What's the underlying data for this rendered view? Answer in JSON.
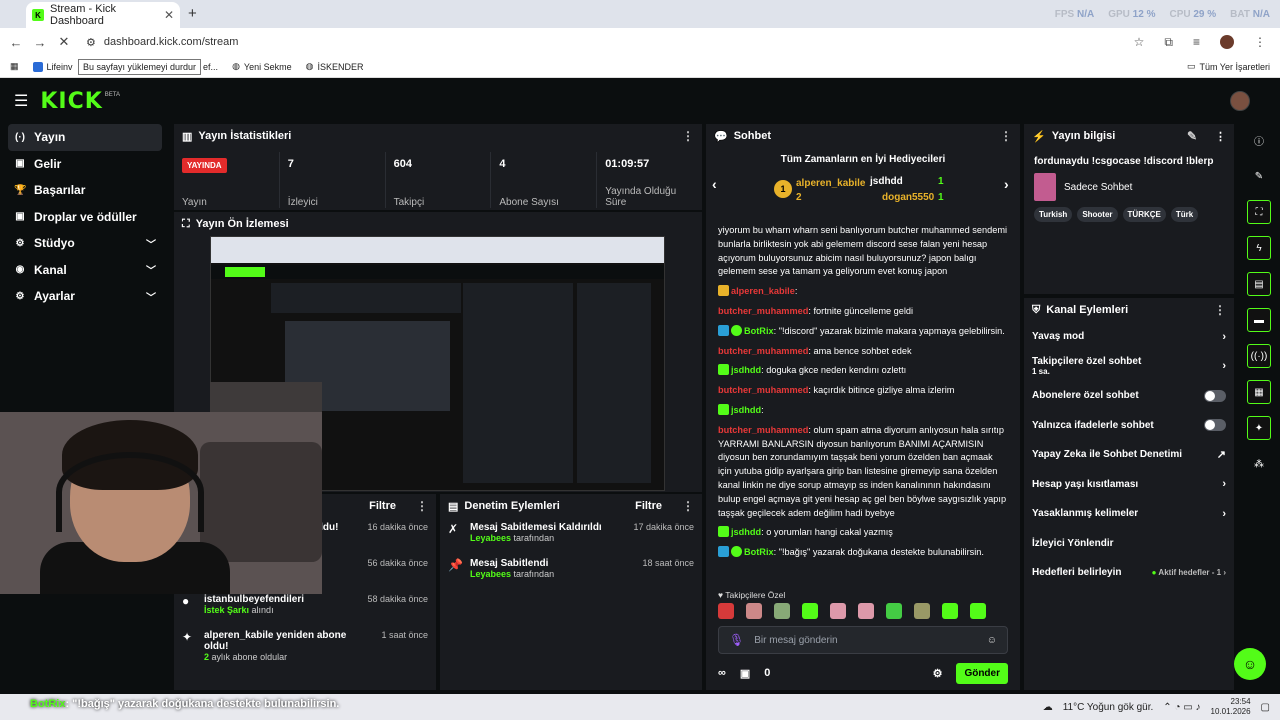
{
  "browser": {
    "tab_title": "Stream - Kick Dashboard",
    "url": "dashboard.kick.com/stream",
    "tooltip": "Bu sayfayı yüklemeyi durdur",
    "bookmarks": [
      "Lifeinv",
      "ancı çizgi film ef...",
      "Yeni Sekme",
      "İSKENDER"
    ],
    "all_bookmarks": "Tüm Yer İşaretleri",
    "overlay": {
      "fps_label": "FPS",
      "fps": "N/A",
      "gpu_label": "GPU",
      "gpu": "12 %",
      "cpu_label": "CPU",
      "cpu": "29 %",
      "bat_label": "BAT",
      "bat": "N/A"
    }
  },
  "brand": {
    "logo": "KICK",
    "beta": "BETA"
  },
  "sidebar": [
    {
      "label": "Yayın",
      "icon": "(·)"
    },
    {
      "label": "Gelir",
      "icon": "▣"
    },
    {
      "label": "Başarılar",
      "icon": "🏆"
    },
    {
      "label": "Droplar ve ödüller",
      "icon": "▣"
    },
    {
      "label": "Stüdyo",
      "icon": "⚙"
    },
    {
      "label": "Kanal",
      "icon": "◉"
    },
    {
      "label": "Ayarlar",
      "icon": "⚙"
    }
  ],
  "stats": {
    "title": "Yayın İstatistikleri",
    "live": "YAYINDA",
    "live_label": "Yayın",
    "viewers": "7",
    "viewers_label": "İzleyici",
    "followers": "604",
    "followers_label": "Takipçi",
    "subs": "4",
    "subs_label": "Abone Sayısı",
    "uptime": "01:09:57",
    "uptime_label": "Yayında Olduğu Süre"
  },
  "preview": {
    "title": "Yayın Ön İzlemesi"
  },
  "activity": {
    "filter": "Filtre",
    "title_tail": "oldu!",
    "rows": [
      {
        "name": "oldu!",
        "sub": "",
        "time": "16 dakika önce"
      },
      {
        "name": "",
        "sub": "",
        "time": "56 dakika önce"
      },
      {
        "name": "istanbulbeyefendileri",
        "sub": "İstek Şarkı",
        "sub2": "alındı",
        "time": "58 dakika önce"
      },
      {
        "name": "alperen_kabile yeniden abone oldu!",
        "sub": "2",
        "sub2": "aylık abone oldular",
        "time": "1 saat önce"
      }
    ]
  },
  "moderation": {
    "title": "Denetim Eylemleri",
    "filter": "Filtre",
    "rows": [
      {
        "name": "Mesaj Sabitlemesi Kaldırıldı",
        "by": "Leyabees",
        "by_tail": "tarafından",
        "time": "17 dakika önce"
      },
      {
        "name": "Mesaj Sabitlendi",
        "by": "Leyabees",
        "by_tail": "tarafından",
        "time": "18 saat önce"
      }
    ]
  },
  "chat": {
    "title": "Sohbet",
    "gifters_title": "Tüm Zamanların en İyi Hediyecileri",
    "gifter1": "alperen_kabile",
    "gifter1_count": "2",
    "gifter2": "jsdhdd",
    "gifter2_count": "1",
    "gifter3": "dogan5550",
    "gifter3_count": "1",
    "messages": [
      {
        "user": "",
        "text": "yiyorum bu wharn wharn seni banlıyorum butcher muhammed sendemi bunlarla birliktesin yok abi gelemem discord sese falan yeni hesap açıyorum buluyorsunuz abicim nasıl buluyorsunuz? japon balıgı gelemem sese ya tamam ya geliyorum evet konuş japon"
      },
      {
        "user": "alperen_kabile",
        "text": ""
      },
      {
        "user": "butcher_muhammed",
        "text": "fortnite güncelleme geldi"
      },
      {
        "user": "BotRix",
        "text": "\"!discord\" yazarak bizimle makara yapmaya gelebilirsin."
      },
      {
        "user": "butcher_muhammed",
        "text": "ama bence sohbet edek"
      },
      {
        "user": "jsdhdd",
        "text": "doguka gkce neden kendını ozlettı"
      },
      {
        "user": "butcher_muhammed",
        "text": "kaçırdık bitince gizliye alma izlerim"
      },
      {
        "user": "jsdhdd",
        "text": ""
      },
      {
        "user": "butcher_muhammed",
        "text": "olum spam atma diyorum anlıyosun hala sırıtıp YARRAMI BANLARSIN diyosun banlıyorum BANIMI AÇARMISIN diyosun ben zorundamıyım taşşak beni yorum özelden ban açmaak için yutuba gidip ayarlşara girip ban listesine giremeyip sana özelden kanal linkin ne diye sorup atmayıp ss inden kanalınının hakındasını bulup engel açmaya git yeni hesap aç gel ben böylwe saygısızlık yapıp taşşak geçilecek adem değilim hadi byebye"
      },
      {
        "user": "jsdhdd",
        "text": "o yorumları hangi cakal yazmış"
      },
      {
        "user": "BotRix",
        "text": "\"!bağış\" yazarak doğukana destekte bulunabilirsin."
      }
    ],
    "followers_only": "Takipçilere Özel",
    "placeholder": "Bir mesaj gönderin",
    "count": "0",
    "send": "Gönder"
  },
  "info": {
    "title": "Yayın bilgisi",
    "stream_title": "fordunaydu !csgocase !discord !blerp",
    "category": "Sadece Sohbet",
    "tags": [
      "Turkish",
      "Shooter",
      "TÜRKÇE",
      "Türk"
    ]
  },
  "channel_actions": {
    "title": "Kanal Eylemleri",
    "slow": "Yavaş mod",
    "followers": "Takipçilere özel sohbet",
    "followers_sub": "1 sa.",
    "subscribers": "Abonelere özel sohbet",
    "emotes": "Yalnızca ifadelerle sohbet",
    "ai": "Yapay Zeka ile Sohbet Denetimi",
    "age": "Hesap yaşı kısıtlaması",
    "banned": "Yasaklanmış kelimeler",
    "viewer_redirect": "İzleyici Yönlendir",
    "goals": "Hedefleri belirleyin",
    "goals_status": "Aktif hedefler - 1"
  },
  "taskbar": {
    "ticker_user": "BotRix",
    "ticker_text": ": \"!bağış\" yazarak doğukana destekte bulunabilirsin.",
    "weather": "11°C Yoğun gök gür.",
    "time": "23:54",
    "date": "10.01.2026"
  }
}
